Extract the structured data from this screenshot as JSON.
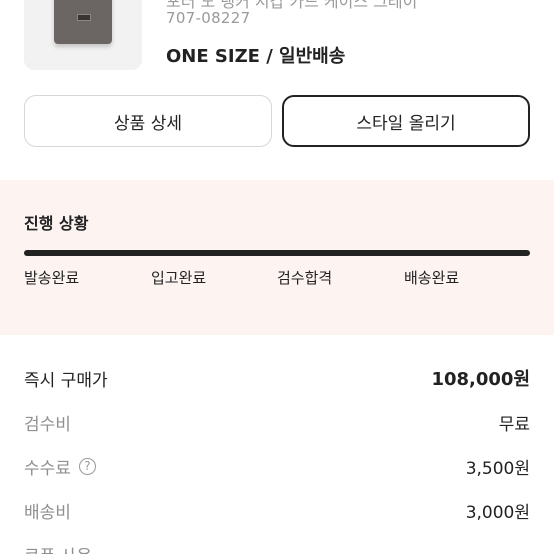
{
  "product": {
    "name_cut": "포터 노 탱커 지갑 카드 케이스 그레이",
    "model_number": "707-08227",
    "option": "ONE SIZE / 일반배송"
  },
  "buttons": {
    "detail_label": "상품 상세",
    "style_label": "스타일 올리기"
  },
  "progress": {
    "title": "진행 상황",
    "fill_percent": 100,
    "current_step": 3,
    "steps": [
      "발송완료",
      "입고완료",
      "검수합격",
      "배송완료"
    ]
  },
  "prices": [
    {
      "label": "즉시 구매가",
      "value": "108,000원"
    },
    {
      "label": "검수비",
      "value": "무료"
    },
    {
      "label": "수수료",
      "value": "3,500원",
      "help_icon": "?"
    },
    {
      "label": "배송비",
      "value": "3,000원"
    },
    {
      "label": "쿠폰 사용",
      "value": ""
    }
  ],
  "colors": {
    "panel_background": "#fdf4f2",
    "progress_fill": "#222222",
    "muted_text": "#8f8f8f"
  },
  "icons": [
    "question-circle-icon"
  ]
}
